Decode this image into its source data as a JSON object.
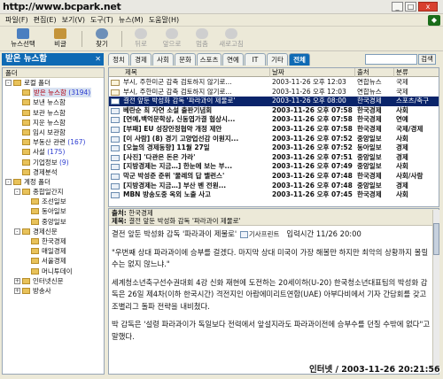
{
  "watermark": "http://www.bcpark.net",
  "menu": [
    "파일(F)",
    "편집(E)",
    "보기(V)",
    "도구(T)",
    "뉴스(M)",
    "도움말(H)"
  ],
  "toolbar": {
    "news_select": "뉴스선택",
    "clip": "비글",
    "find": "찾기",
    "back": "뒤로",
    "forward": "앞으로",
    "stop": "멈춤",
    "refresh": "새로고침"
  },
  "folder_pane_title": "받은 뉴스함",
  "tree": {
    "caption": "폴더",
    "items": [
      {
        "label": "로컬 폴더",
        "count": "",
        "level": 0,
        "expander": "-"
      },
      {
        "label": "받은 뉴스함",
        "count": "(3194)",
        "level": 1,
        "expander": "",
        "selected": true
      },
      {
        "label": "보낸 뉴스함",
        "count": "",
        "level": 1,
        "expander": ""
      },
      {
        "label": "보관 뉴스함",
        "count": "",
        "level": 1,
        "expander": ""
      },
      {
        "label": "지운 뉴스함",
        "count": "",
        "level": 1,
        "expander": ""
      },
      {
        "label": "임시 보관함",
        "count": "",
        "level": 1,
        "expander": ""
      },
      {
        "label": "부동산 관련",
        "count": "(167)",
        "level": 1,
        "expander": ""
      },
      {
        "label": "사설",
        "count": "(175)",
        "level": 1,
        "expander": ""
      },
      {
        "label": "기업정보",
        "count": "(9)",
        "level": 1,
        "expander": ""
      },
      {
        "label": "경제분석",
        "count": "",
        "level": 1,
        "expander": ""
      },
      {
        "label": "계정 폴더",
        "count": "",
        "level": 0,
        "expander": "-"
      },
      {
        "label": "종합일간지",
        "count": "",
        "level": 1,
        "expander": "-"
      },
      {
        "label": "조선일보",
        "count": "",
        "level": 2,
        "expander": ""
      },
      {
        "label": "동아일보",
        "count": "",
        "level": 2,
        "expander": ""
      },
      {
        "label": "중앙일보",
        "count": "",
        "level": 2,
        "expander": ""
      },
      {
        "label": "경제신문",
        "count": "",
        "level": 1,
        "expander": "-"
      },
      {
        "label": "한국경제",
        "count": "",
        "level": 2,
        "expander": ""
      },
      {
        "label": "매일경제",
        "count": "",
        "level": 2,
        "expander": ""
      },
      {
        "label": "서울경제",
        "count": "",
        "level": 2,
        "expander": ""
      },
      {
        "label": "머니투데이",
        "count": "",
        "level": 2,
        "expander": ""
      },
      {
        "label": "인터넷신문",
        "count": "",
        "level": 1,
        "expander": "+"
      },
      {
        "label": "방송사",
        "count": "",
        "level": 1,
        "expander": "+"
      }
    ]
  },
  "tabs": [
    "정치",
    "경제",
    "사회",
    "문화",
    "스포츠",
    "연예",
    "IT",
    "기타",
    "전체"
  ],
  "active_tab": "전체",
  "search": {
    "button": "검색"
  },
  "list": {
    "columns": [
      "제목",
      "날짜",
      "출처",
      "분류"
    ],
    "rows": [
      {
        "title": "부시, 주한미군 감축 검토하지 않기로...",
        "date": "2003-11-26 오후 12:03",
        "source": "연합뉴스",
        "category": "국제",
        "pinned": true
      },
      {
        "title": "부시, 주한미군 감축 검토하지 않기로...",
        "date": "2003-11-26 오후 12:03",
        "source": "연합뉴스",
        "category": "국제",
        "pinned": true
      },
      {
        "title": "결전 앞둔 박성화 감독 '파라과이 제물로'",
        "date": "2003-11-26 오후 08:00",
        "source": "한국경제",
        "category": "스포츠/축구",
        "selected": true
      },
      {
        "title": "베란순 최 자연 소설 출판기념회",
        "date": "2003-11-26 오후 07:58",
        "source": "한국경제",
        "category": "사회",
        "bold": true
      },
      {
        "title": "[연예,백억문학상, 신동엽가결 협상시...",
        "date": "2003-11-26 오후 07:58",
        "source": "한국경제",
        "category": "연예",
        "bold": true
      },
      {
        "title": "[부패] EU 성장안정협약 개정 제안",
        "date": "2003-11-26 오후 07:58",
        "source": "한국경제",
        "category": "국제/경제",
        "bold": true
      },
      {
        "title": "[이 사람] (8) 경기 고양업선감 이원지...",
        "date": "2003-11-26 오후 07:52",
        "source": "중앙일보",
        "category": "사회",
        "bold": true
      },
      {
        "title": "[오늘의 경제동향] 11월 27일",
        "date": "2003-11-26 오후 07:52",
        "source": "동아일보",
        "category": "경제",
        "bold": true
      },
      {
        "title": "[사진] '다관은 돈은 가라'",
        "date": "2003-11-26 오후 07:51",
        "source": "중앙일보",
        "category": "경제",
        "bold": true
      },
      {
        "title": "[지방경제는 지금…] 한눈에 보는 부...",
        "date": "2003-11-26 오후 07:49",
        "source": "중앙일보",
        "category": "사회",
        "bold": true
      },
      {
        "title": "막군 박성준 준위 '물레의 답 밸런스'",
        "date": "2003-11-26 오후 07:48",
        "source": "한국경제",
        "category": "사회/사람",
        "bold": true
      },
      {
        "title": "[지방경제는 지금…] 부산 벤 전원...",
        "date": "2003-11-26 오후 07:48",
        "source": "중앙일보",
        "category": "경제",
        "bold": true
      },
      {
        "title": "MBN 방송도중 옥외 노출 사고",
        "date": "2003-11-26 오후 07:45",
        "source": "한국경제",
        "category": "사회",
        "bold": true
      }
    ]
  },
  "preview": {
    "from_label": "출처:",
    "from": "한국경제",
    "subject_label": "제목:",
    "subject": "결전 앞둔 박성화 감독 '파라과이 제물로'",
    "headline": "결전 앞둔 박성화 감독 '파라과이 제물로'",
    "reporter": "기사프린트",
    "time": "입력시간 11/26 20:00",
    "paragraphs": [
      "\"우번째 상대 파라과이에 승부를 걸겠다. 마지막 상대 미국이 가장 해볼만 하지만 최악의 상황까지 몰릴 수는 없지 않느냐.\"",
      "세계청소년축구선수권대회 4강 신화 재현에 도전하는 20세이하(U-20) 한국청소년대표팀의 박성화 감독은 26일 제4차(이하 한국시간) 격전지인 아랍에미리트연합(UAE) 아부다비에서 기자 간담회를 갖고 조별리그 돌파 전략을 내비쳤다.",
      "박 감독은 '설령 파라과이가 독일보다 전력에서 앞설지라도 파라과이전에 승부수를 던질 수밖에 없다\"고 말했다."
    ]
  },
  "status": "인터넷 / 2003-11-26 20:21:56"
}
